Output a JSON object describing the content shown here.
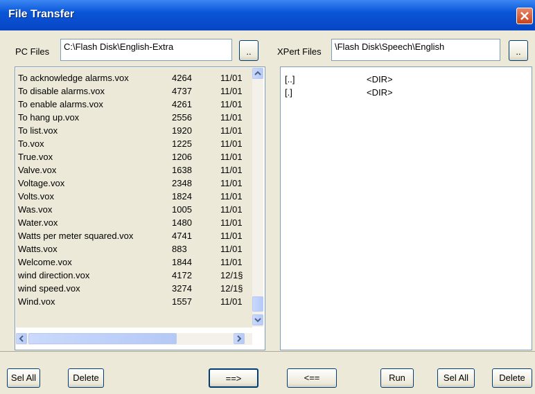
{
  "window": {
    "title": "File Transfer"
  },
  "pc": {
    "label": "PC Files",
    "path": "C:\\Flash Disk\\English-Extra",
    "browse_label": "..",
    "files": [
      {
        "name": "To acknowledge alarms.vox",
        "size": "4264",
        "date": "11/01"
      },
      {
        "name": "To disable alarms.vox",
        "size": "4737",
        "date": "11/01"
      },
      {
        "name": "To enable alarms.vox",
        "size": "4261",
        "date": "11/01"
      },
      {
        "name": "To hang up.vox",
        "size": "2556",
        "date": "11/01"
      },
      {
        "name": "To list.vox",
        "size": "1920",
        "date": "11/01"
      },
      {
        "name": "To.vox",
        "size": "1225",
        "date": "11/01"
      },
      {
        "name": "True.vox",
        "size": "1206",
        "date": "11/01"
      },
      {
        "name": "Valve.vox",
        "size": "1638",
        "date": "11/01"
      },
      {
        "name": "Voltage.vox",
        "size": "2348",
        "date": "11/01"
      },
      {
        "name": "Volts.vox",
        "size": "1824",
        "date": "11/01"
      },
      {
        "name": "Was.vox",
        "size": "1005",
        "date": "11/01"
      },
      {
        "name": "Water.vox",
        "size": "1480",
        "date": "11/01"
      },
      {
        "name": "Watts per meter squared.vox",
        "size": "4741",
        "date": "11/01"
      },
      {
        "name": "Watts.vox",
        "size": "883",
        "date": "11/01"
      },
      {
        "name": "Welcome.vox",
        "size": "1844",
        "date": "11/01"
      },
      {
        "name": "wind direction.vox",
        "size": "4172",
        "date": "12/1§"
      },
      {
        "name": "wind speed.vox",
        "size": "3274",
        "date": "12/1§"
      },
      {
        "name": "Wind.vox",
        "size": "1557",
        "date": "11/01"
      }
    ]
  },
  "xpert": {
    "label": "XPert Files",
    "path": "\\Flash Disk\\Speech\\English",
    "browse_label": "..",
    "entries": [
      {
        "name": "[..]",
        "type": "<DIR>"
      },
      {
        "name": "[.]",
        "type": "<DIR>"
      }
    ]
  },
  "buttons": {
    "sel_all_left": "Sel All",
    "delete_left": "Delete",
    "copy_right": "==>",
    "copy_left": "<==",
    "run": "Run",
    "sel_all_right": "Sel All",
    "delete_right": "Delete"
  },
  "colors": {
    "title_bar": "#0a56d8",
    "selection": "#ece9d8",
    "window_bg": "#ece9d8"
  },
  "icons": {
    "close": "close-icon",
    "scroll_up": "arrow-up-icon",
    "scroll_down": "arrow-down-icon",
    "scroll_left": "arrow-left-icon",
    "scroll_right": "arrow-right-icon"
  }
}
